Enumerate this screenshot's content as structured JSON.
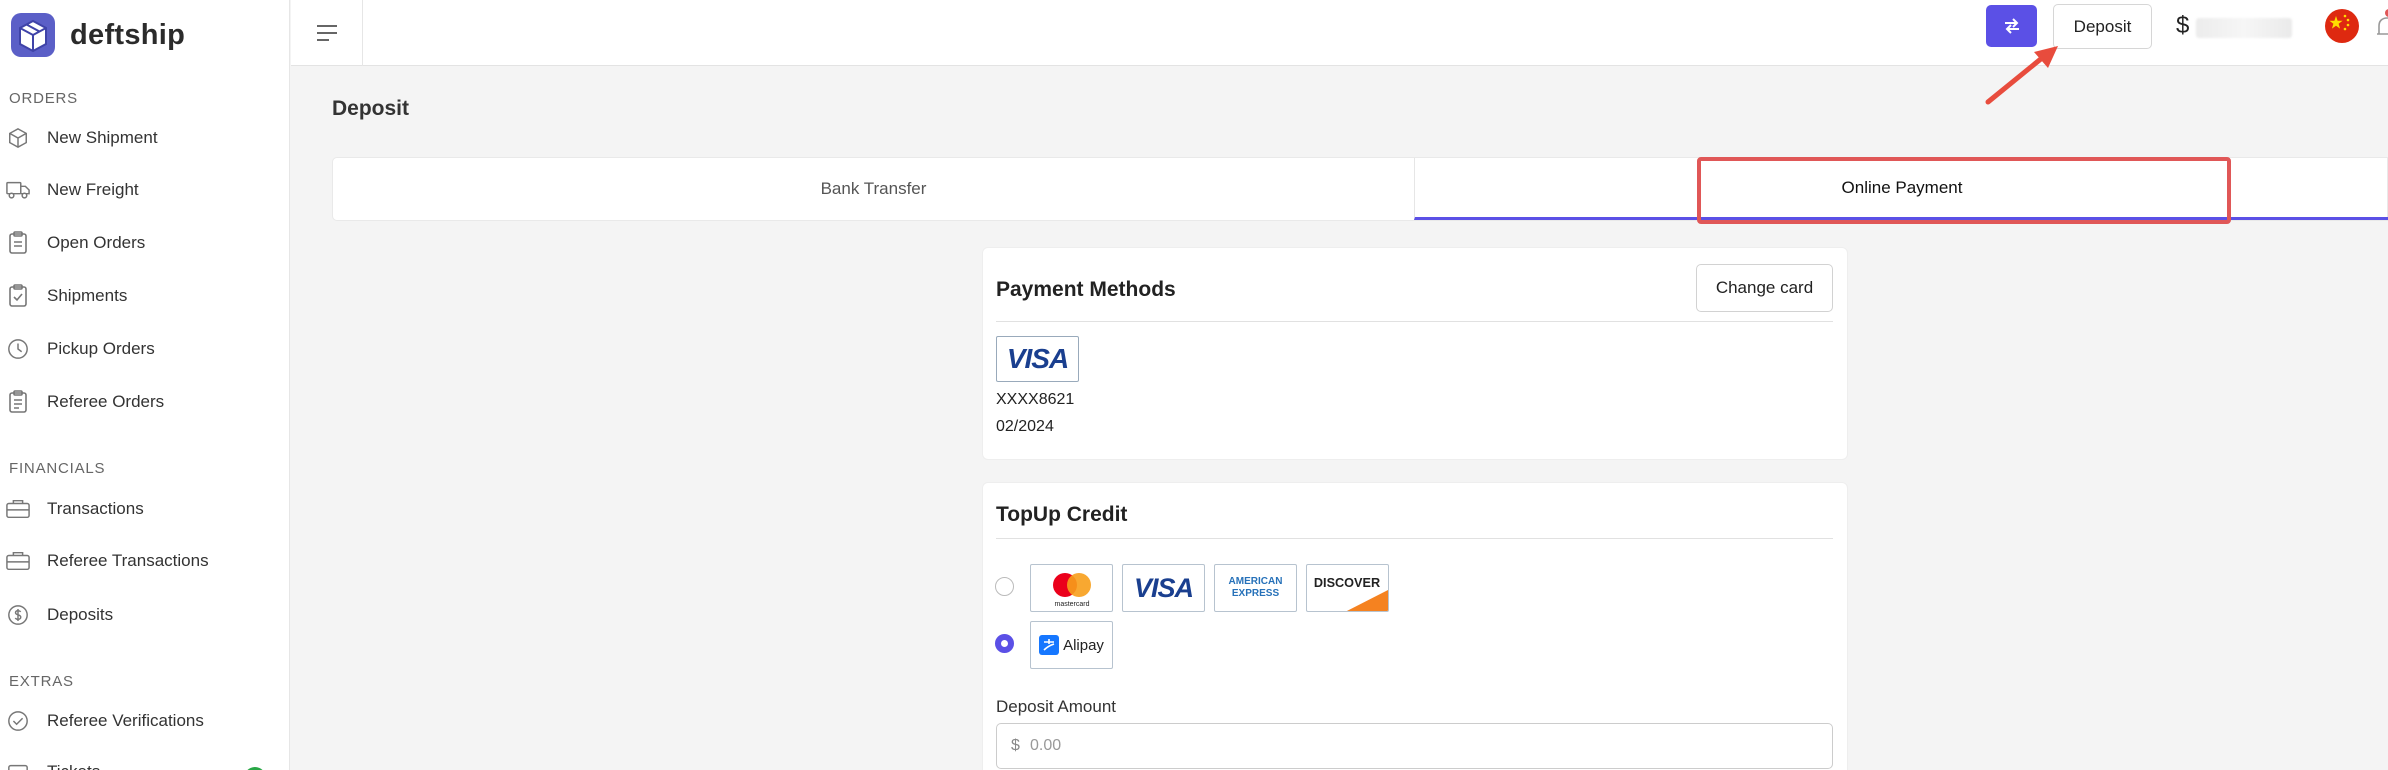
{
  "brand": {
    "name": "deftship"
  },
  "sidebar": {
    "sections": [
      {
        "title": "ORDERS",
        "items": [
          {
            "label": "New Shipment",
            "icon": "box-icon"
          },
          {
            "label": "New Freight",
            "icon": "truck-icon"
          },
          {
            "label": "Open Orders",
            "icon": "clipboard-icon"
          },
          {
            "label": "Shipments",
            "icon": "clipboard-check-icon"
          },
          {
            "label": "Pickup Orders",
            "icon": "clock-icon"
          },
          {
            "label": "Referee Orders",
            "icon": "clipboard-list-icon"
          }
        ]
      },
      {
        "title": "FINANCIALS",
        "items": [
          {
            "label": "Transactions",
            "icon": "wallet-icon"
          },
          {
            "label": "Referee Transactions",
            "icon": "wallet-icon"
          },
          {
            "label": "Deposits",
            "icon": "dollar-circle-icon"
          }
        ]
      },
      {
        "title": "EXTRAS",
        "items": [
          {
            "label": "Referee Verifications",
            "icon": "check-circle-icon"
          },
          {
            "label": "Tickets",
            "icon": "ticket-icon"
          }
        ]
      }
    ]
  },
  "topbar": {
    "deposit_label": "Deposit",
    "balance_symbol": "$",
    "accent_color": "#5b50e6"
  },
  "page": {
    "title": "Deposit",
    "tabs": [
      {
        "label": "Bank Transfer",
        "active": false
      },
      {
        "label": "Online Payment",
        "active": true
      }
    ]
  },
  "payment_methods": {
    "title": "Payment Methods",
    "change_card_label": "Change card",
    "card_brand": "VISA",
    "card_number": "XXXX8621",
    "card_expiry": "02/2024"
  },
  "topup": {
    "title": "TopUp Credit",
    "options": [
      {
        "logos": [
          "mastercard",
          "VISA",
          "AMERICAN EXPRESS",
          "DISCOVER"
        ],
        "selected": false
      },
      {
        "logos": [
          "Alipay"
        ],
        "selected": true
      }
    ],
    "mastercard_text": "mastercard",
    "visa_text": "VISA",
    "amex_line1": "AMERICAN",
    "amex_line2": "EXPRESS",
    "discover_text": "DISCOVER",
    "alipay_text": "Alipay",
    "amount_label": "Deposit Amount",
    "amount_prefix": "$",
    "amount_placeholder": "0.00"
  }
}
